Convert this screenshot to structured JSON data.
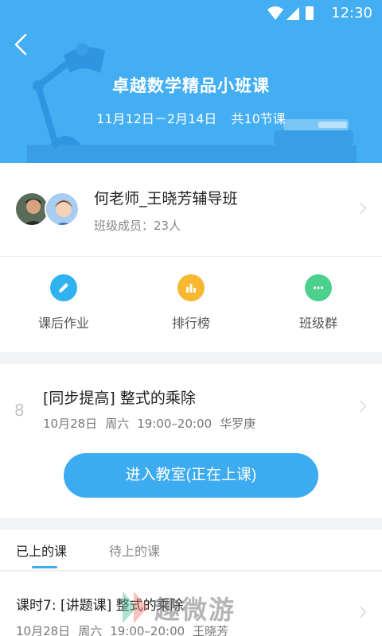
{
  "status": {
    "time": "12:30"
  },
  "header": {
    "title": "卓越数学精品小班课",
    "date_range": "11月12日－2月14日",
    "lesson_count": "共10节课",
    "bg_color": "#44aef3"
  },
  "class_card": {
    "name": "何老师_王晓芳辅导班",
    "members": "班级成员：23人"
  },
  "actions": [
    {
      "label": "课后作业",
      "icon": "pencil-icon",
      "color": "#2fb2ef"
    },
    {
      "label": "排行榜",
      "icon": "bar-chart-icon",
      "color": "#f7b731"
    },
    {
      "label": "班级群",
      "icon": "chat-bubble-icon",
      "color": "#4cd18d"
    }
  ],
  "current_lesson": {
    "number": "8",
    "title": "[同步提高] 整式的乘除",
    "date": "10月28日",
    "weekday": "周六",
    "time": "19:00–20:00",
    "teacher": "华罗庚",
    "button_label": "进入教室(正在上课)"
  },
  "tabs": [
    {
      "label": "已上的课",
      "active": true
    },
    {
      "label": "待上的课",
      "active": false
    }
  ],
  "lesson_list": [
    {
      "title": "课时7: [讲题课] 整式的乘除",
      "date": "10月28日",
      "weekday": "周六",
      "time": "19:00–20:00",
      "teacher": "王晓芳"
    }
  ],
  "watermark": {
    "text": "趣微游"
  },
  "colors": {
    "accent": "#3cabf0"
  }
}
